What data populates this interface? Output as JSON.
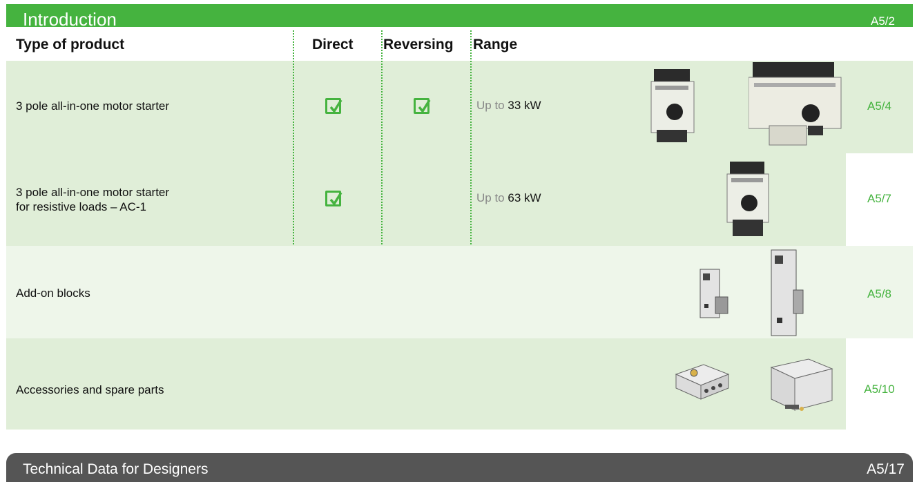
{
  "intro": {
    "title": "Introduction",
    "ref": "A5/2"
  },
  "headers": {
    "type": "Type of product",
    "direct": "Direct",
    "reversing": "Reversing",
    "range": "Range"
  },
  "rows": [
    {
      "name": "3 pole all-in-one motor starter",
      "range_prefix": "Up to ",
      "range_value": "33 kW",
      "ref": "A5/4",
      "direct": true,
      "reversing": true
    },
    {
      "name": "3 pole all-in-one motor starter",
      "name2": "for resistive loads – AC-1",
      "range_prefix": "Up to ",
      "range_value": "63 kW",
      "ref": "A5/7",
      "direct": true,
      "reversing": false
    },
    {
      "name": "Add-on blocks",
      "ref": "A5/8"
    },
    {
      "name": "Accessories and spare parts",
      "ref": "A5/10"
    }
  ],
  "footer": {
    "title": "Technical Data for Designers",
    "ref": "A5/17"
  },
  "colors": {
    "accent": "#45b33f",
    "row_dark": "#e0eed8",
    "row_light": "#eef6ea",
    "footer_bar": "#555555"
  }
}
